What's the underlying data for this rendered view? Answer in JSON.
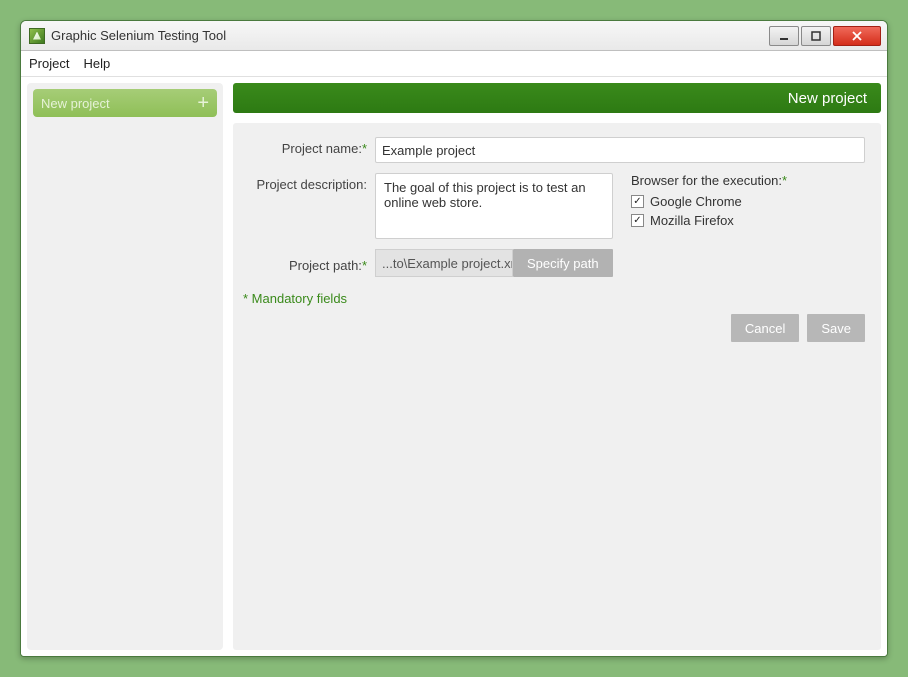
{
  "window": {
    "title": "Graphic Selenium Testing Tool"
  },
  "menu": {
    "project": "Project",
    "help": "Help"
  },
  "sidebar": {
    "new_project": "New project"
  },
  "header": {
    "title": "New project"
  },
  "form": {
    "labels": {
      "project_name": "Project name:",
      "project_description": "Project description:",
      "project_path": "Project path:",
      "browser_heading": "Browser for the execution:"
    },
    "values": {
      "project_name": "Example project",
      "project_description": "The goal of this project is to test an online web store.",
      "project_path": "...to\\Example project.xml"
    },
    "browsers": [
      {
        "label": "Google Chrome",
        "checked": true
      },
      {
        "label": "Mozilla Firefox",
        "checked": true
      }
    ],
    "specify_path_btn": "Specify path",
    "mandatory_note": "* Mandatory fields"
  },
  "buttons": {
    "cancel": "Cancel",
    "save": "Save"
  },
  "marks": {
    "asterisk": "*",
    "check": "✓"
  }
}
